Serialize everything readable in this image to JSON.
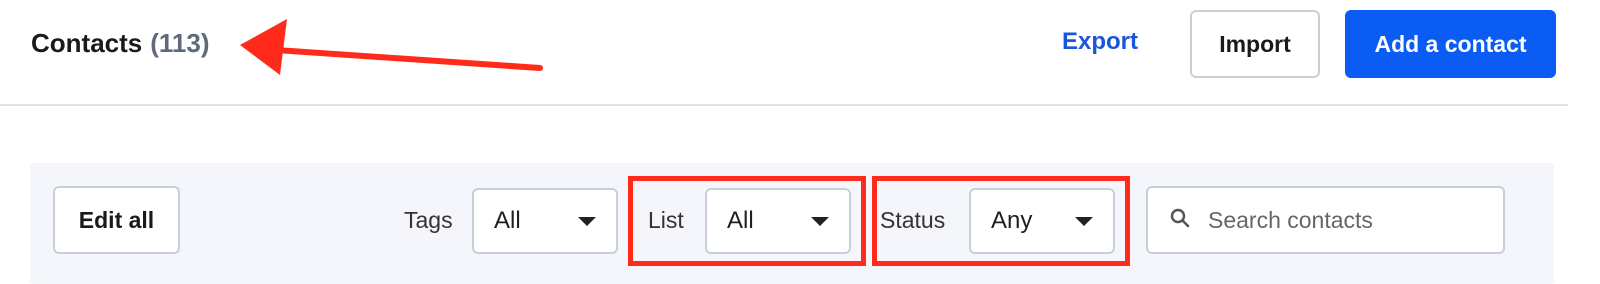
{
  "header": {
    "title": "Contacts",
    "count": "(113)",
    "export_label": "Export",
    "import_label": "Import",
    "add_label": "Add a contact"
  },
  "toolbar": {
    "edit_all_label": "Edit all",
    "tags_label": "Tags",
    "tags_value": "All",
    "list_label": "List",
    "list_value": "All",
    "status_label": "Status",
    "status_value": "Any",
    "search_placeholder": "Search contacts"
  },
  "colors": {
    "primary": "#0b5cf5",
    "link": "#1a56db",
    "annotation": "#ff2a1a"
  },
  "icons": {
    "search": "search-icon",
    "caret": "chevron-down-icon",
    "annotation": "annotation-arrow"
  }
}
